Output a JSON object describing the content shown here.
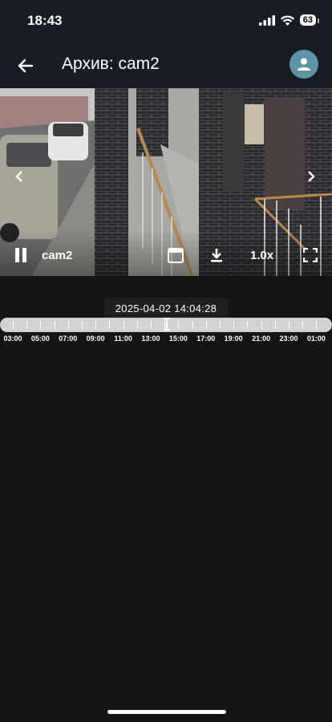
{
  "status": {
    "time": "18:43",
    "battery": "63"
  },
  "appbar": {
    "title": "Архив: cam2"
  },
  "player": {
    "camera_label": "cam2",
    "speed_label": "1.0x"
  },
  "timeline": {
    "current_time": "2025-04-02 14:04:28",
    "hours": [
      "03:00",
      "05:00",
      "07:00",
      "09:00",
      "11:00",
      "13:00",
      "15:00",
      "17:00",
      "19:00",
      "21:00",
      "23:00",
      "01:00"
    ]
  },
  "icons": {
    "back": "arrow-left-icon",
    "avatar": "person-icon",
    "prev": "chevron-left-icon",
    "next": "chevron-right-icon",
    "pause": "pause-icon",
    "calendar": "calendar-icon",
    "download": "download-icon",
    "fullscreen": "fullscreen-icon"
  },
  "colors": {
    "appbar_bg": "#181c24",
    "page_bg": "#141414",
    "avatar_bg": "#5d97a6",
    "timeline_track": "#d2d2d2"
  }
}
